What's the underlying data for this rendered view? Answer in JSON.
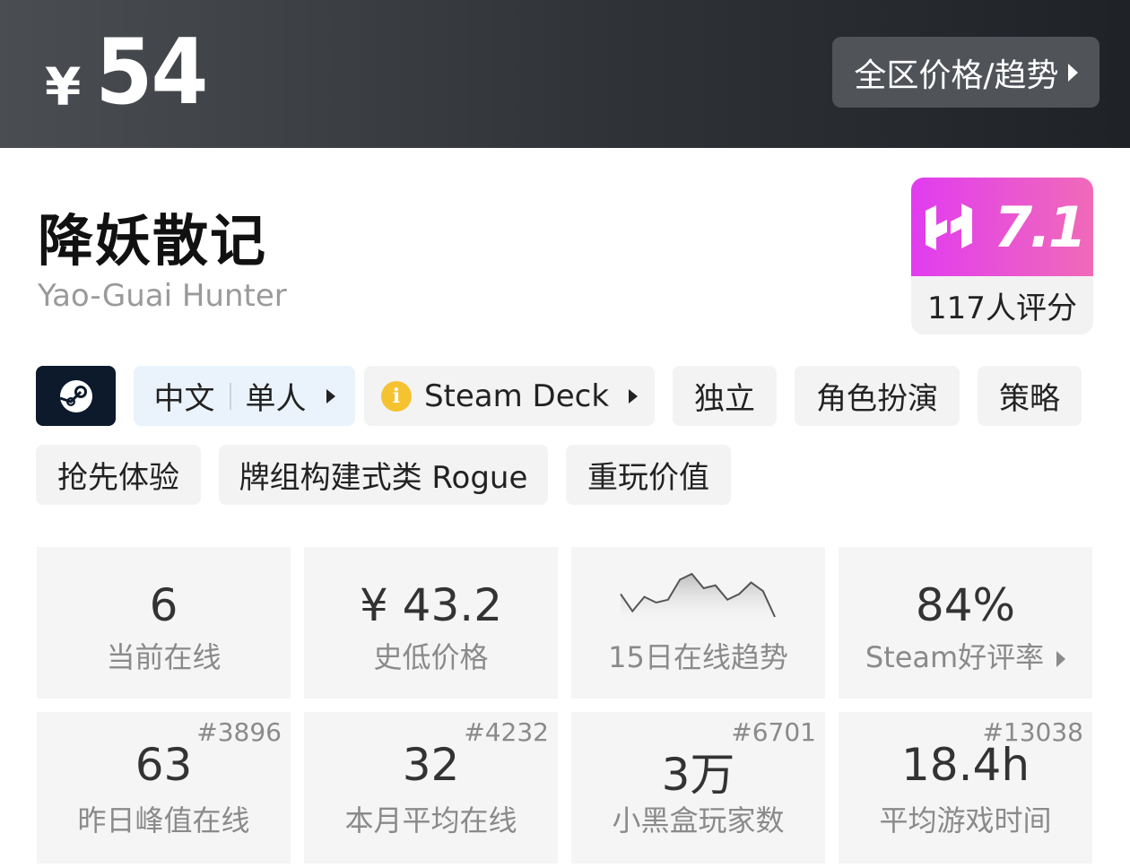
{
  "header": {
    "currency_symbol": "¥",
    "price": "54",
    "trend_button_label": "全区价格/趋势"
  },
  "game": {
    "title_cn": "降妖散记",
    "title_en": "Yao-Guai Hunter"
  },
  "score": {
    "value": "7.1",
    "raters": "117人评分",
    "brand_color": "#e13cf0"
  },
  "tags": {
    "lang": "中文",
    "mode": "单人",
    "deck": "Steam Deck",
    "items": [
      "独立",
      "角色扮演",
      "策略",
      "抢先体验",
      "牌组构建式类 Rogue",
      "重玩价值"
    ]
  },
  "stats_row1": [
    {
      "value": "6",
      "label": "当前在线"
    },
    {
      "value": "¥ 43.2",
      "label": "史低价格"
    },
    {
      "value": "",
      "label": "15日在线趋势"
    },
    {
      "value": "84%",
      "label": "Steam好评率"
    }
  ],
  "stats_row2": [
    {
      "rank": "#3896",
      "value": "63",
      "label": "昨日峰值在线"
    },
    {
      "rank": "#4232",
      "value": "32",
      "label": "本月平均在线"
    },
    {
      "rank": "#6701",
      "value": "3万",
      "label": "小黑盒玩家数"
    },
    {
      "rank": "#13038",
      "value": "18.4h",
      "label": "平均游戏时间"
    }
  ],
  "sparkline": [
    5,
    2,
    4.5,
    3.5,
    4,
    7.5,
    8.5,
    6,
    6.5,
    4,
    5,
    7,
    5.5,
    1
  ]
}
